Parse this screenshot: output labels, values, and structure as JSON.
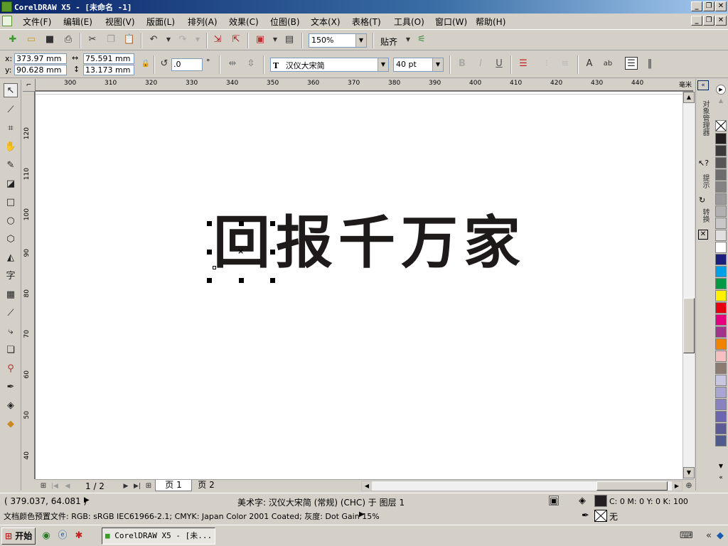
{
  "window": {
    "title": "CorelDRAW X5 - [未命名 -1]"
  },
  "menu": [
    "文件(F)",
    "编辑(E)",
    "视图(V)",
    "版面(L)",
    "排列(A)",
    "效果(C)",
    "位图(B)",
    "文本(X)",
    "表格(T)",
    "工具(O)",
    "窗口(W)",
    "帮助(H)"
  ],
  "std_toolbar": {
    "zoom": "150%",
    "snap_label": "贴齐"
  },
  "property_bar": {
    "x_label": "x:",
    "x_value": "373.97 mm",
    "y_label": "y:",
    "y_value": "90.628 mm",
    "w_value": "75.591 mm",
    "h_value": "13.173 mm",
    "angle_value": ".0",
    "angle_unit": "°",
    "font_name": "汉仪大宋简",
    "font_size": "40 pt",
    "bold": "B",
    "italic": "I",
    "underline": "U"
  },
  "ruler": {
    "unit": "毫米",
    "h_ticks": [
      "300",
      "310",
      "320",
      "330",
      "340",
      "350",
      "360",
      "370",
      "380",
      "390",
      "400",
      "410",
      "420",
      "430",
      "440"
    ],
    "v_ticks": [
      "120",
      "110",
      "100",
      "90",
      "80",
      "70",
      "60",
      "50",
      "40"
    ]
  },
  "canvas": {
    "artistic_text": "回报千万家"
  },
  "pages": {
    "counter": "1 / 2",
    "tab1": "页 1",
    "tab2": "页 2"
  },
  "status": {
    "coords": "( 379.037, 64.081 )",
    "object_info": "美术字: 汉仪大宋简 (常规) (CHC) 于 图层 1",
    "fill_info": "C: 0 M: 0 Y: 0 K: 100",
    "profile_info": "文档颜色预置文件: RGB: sRGB IEC61966-2.1; CMYK: Japan Color 2001 Coated; 灰度: Dot Gain 15%",
    "outline_info": "无"
  },
  "dockers": {
    "object_manager": "对象管理器",
    "hints": "提示",
    "transform": "转换"
  },
  "taskbar": {
    "start": "开始",
    "app_task": "CorelDRAW X5 - [未..."
  },
  "palette": [
    "#231f20",
    "#3d3a3b",
    "#595657",
    "#6f6c6d",
    "#858283",
    "#9c999a",
    "#b3b0b1",
    "#cac7c8",
    "#e1dfe0",
    "#ffffff",
    "#1b1f7c",
    "#00a0e9",
    "#009944",
    "#fff100",
    "#e60012",
    "#e4007f",
    "#a3348b",
    "#f08300",
    "#f7c0c0",
    "#8c7b70",
    "#c8c6e0",
    "#a8a6d0",
    "#8883c0",
    "#6c66ae",
    "#5d5b95",
    "#4f5b8c"
  ]
}
